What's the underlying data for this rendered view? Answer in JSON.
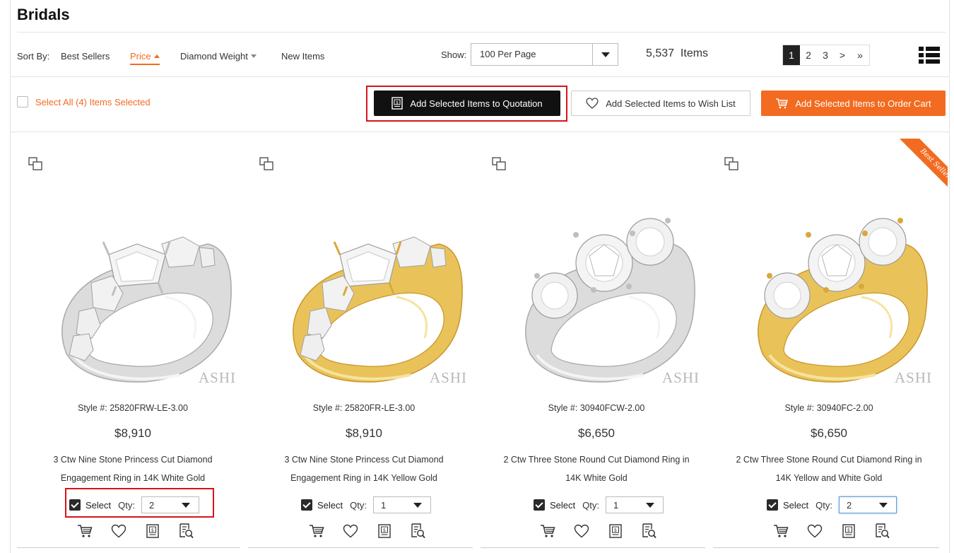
{
  "page": {
    "title": "Bridals"
  },
  "sort": {
    "label": "Sort By:",
    "options": [
      "Best Sellers",
      "Price",
      "Diamond Weight",
      "New Items"
    ],
    "active": "Price"
  },
  "show": {
    "label": "Show:",
    "selected": "100 Per Page"
  },
  "items_count": "5,537  Items",
  "pagination": [
    "1",
    "2",
    "3",
    ">",
    "»"
  ],
  "selection": {
    "select_all_text": "Select All (4) Items Selected"
  },
  "actions": {
    "quotation": "Add Selected Items to Quotation",
    "wishlist": "Add Selected Items to Wish List",
    "cart": "Add Selected Items to Order Cart"
  },
  "brand_watermark": "ASHI",
  "badge": {
    "best_seller": "Best Seller"
  },
  "product_labels": {
    "select": "Select",
    "qty": "Qty:"
  },
  "products": [
    {
      "style": "Style #: 25820FRW-LE-3.00",
      "price": "$8,910",
      "name_line1": "3 Ctw Nine Stone Princess Cut Diamond",
      "name_line2": "Engagement Ring in 14K White Gold",
      "qty": "2",
      "metal": "white"
    },
    {
      "style": "Style #: 25820FR-LE-3.00",
      "price": "$8,910",
      "name_line1": "3 Ctw Nine Stone Princess Cut Diamond",
      "name_line2": "Engagement Ring in 14K Yellow Gold",
      "qty": "1",
      "metal": "yellow"
    },
    {
      "style": "Style #: 30940FCW-2.00",
      "price": "$6,650",
      "name_line1": "2 Ctw Three Stone Round Cut Diamond Ring in",
      "name_line2": "14K White Gold",
      "qty": "1",
      "metal": "white"
    },
    {
      "style": "Style #: 30940FC-2.00",
      "price": "$6,650",
      "name_line1": "2 Ctw Three Stone Round Cut Diamond Ring in",
      "name_line2": "14K Yellow and White Gold",
      "qty": "2",
      "metal": "yellow"
    }
  ],
  "colors": {
    "accent": "#f26b21",
    "dark": "#111111",
    "highlight": "#d4141b"
  },
  "icons": [
    "compare-icon",
    "cart-icon",
    "heart-icon",
    "quotation-icon",
    "details-icon",
    "list-view-icon",
    "chevron-down-icon"
  ]
}
